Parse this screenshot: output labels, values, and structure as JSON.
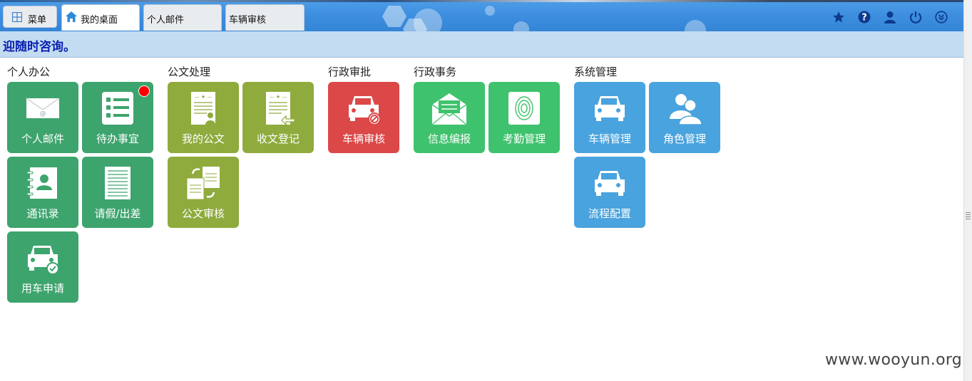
{
  "tabs": {
    "menu": "菜单",
    "desktop": "我的桌面",
    "mail": "个人邮件",
    "vehicle_review": "车辆审核"
  },
  "top_icons": [
    "star-icon",
    "help-icon",
    "user-icon",
    "power-icon",
    "collapse-icon"
  ],
  "notice": "迎随时咨询。",
  "groups": {
    "personal": "个人办公",
    "document": "公文处理",
    "admin_approval": "行政审批",
    "admin_affairs": "行政事务",
    "system": "系统管理"
  },
  "tiles": {
    "mail": "个人邮件",
    "todo": "待办事宜",
    "contacts": "通讯录",
    "leave": "请假/出差",
    "car_request": "用车申请",
    "my_docs": "我的公文",
    "doc_register": "收文登记",
    "doc_review": "公文审核",
    "vehicle_review": "车辆审核",
    "info_report": "信息编报",
    "attendance": "考勤管理",
    "vehicle_mgmt": "车辆管理",
    "role_mgmt": "角色管理",
    "flow_config": "流程配置"
  },
  "colors": {
    "personal": "#3da46d",
    "document": "#8fab3d",
    "approval": "#dc4848",
    "affairs": "#3fc26d",
    "system": "#49a3de",
    "notice_text": "#0a1fb0"
  },
  "watermark": "www.wooyun.org"
}
